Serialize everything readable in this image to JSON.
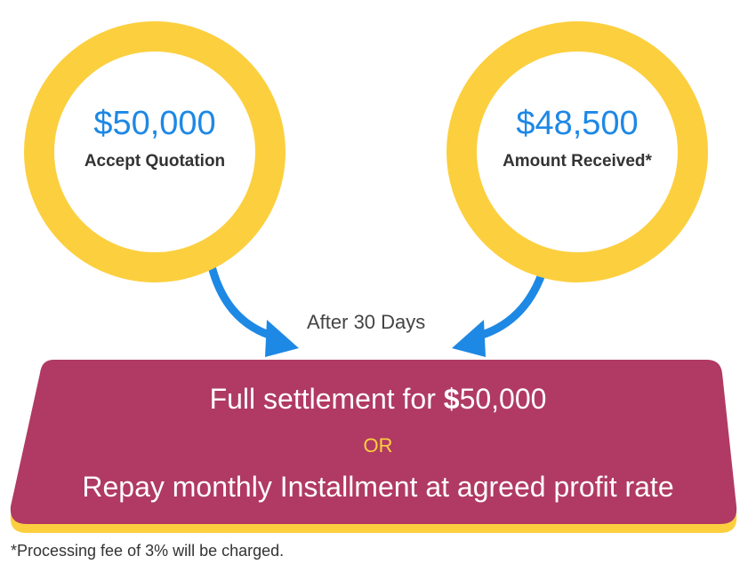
{
  "colors": {
    "ring": "#fccf3e",
    "amount_blue": "#1e88e5",
    "banner": "#b03a63",
    "arrow": "#1e88e5"
  },
  "left_circle": {
    "amount": "$50,000",
    "caption": "Accept Quotation"
  },
  "right_circle": {
    "amount": "$48,500",
    "caption": "Amount Received*"
  },
  "connector_label": "After 30 Days",
  "banner": {
    "line1_prefix": "Full settlement for ",
    "line1_dollar": "$",
    "line1_amount": "50,000",
    "separator": "OR",
    "line2": "Repay monthly Installment at agreed profit rate"
  },
  "footnote": "*Processing fee of 3% will be charged."
}
